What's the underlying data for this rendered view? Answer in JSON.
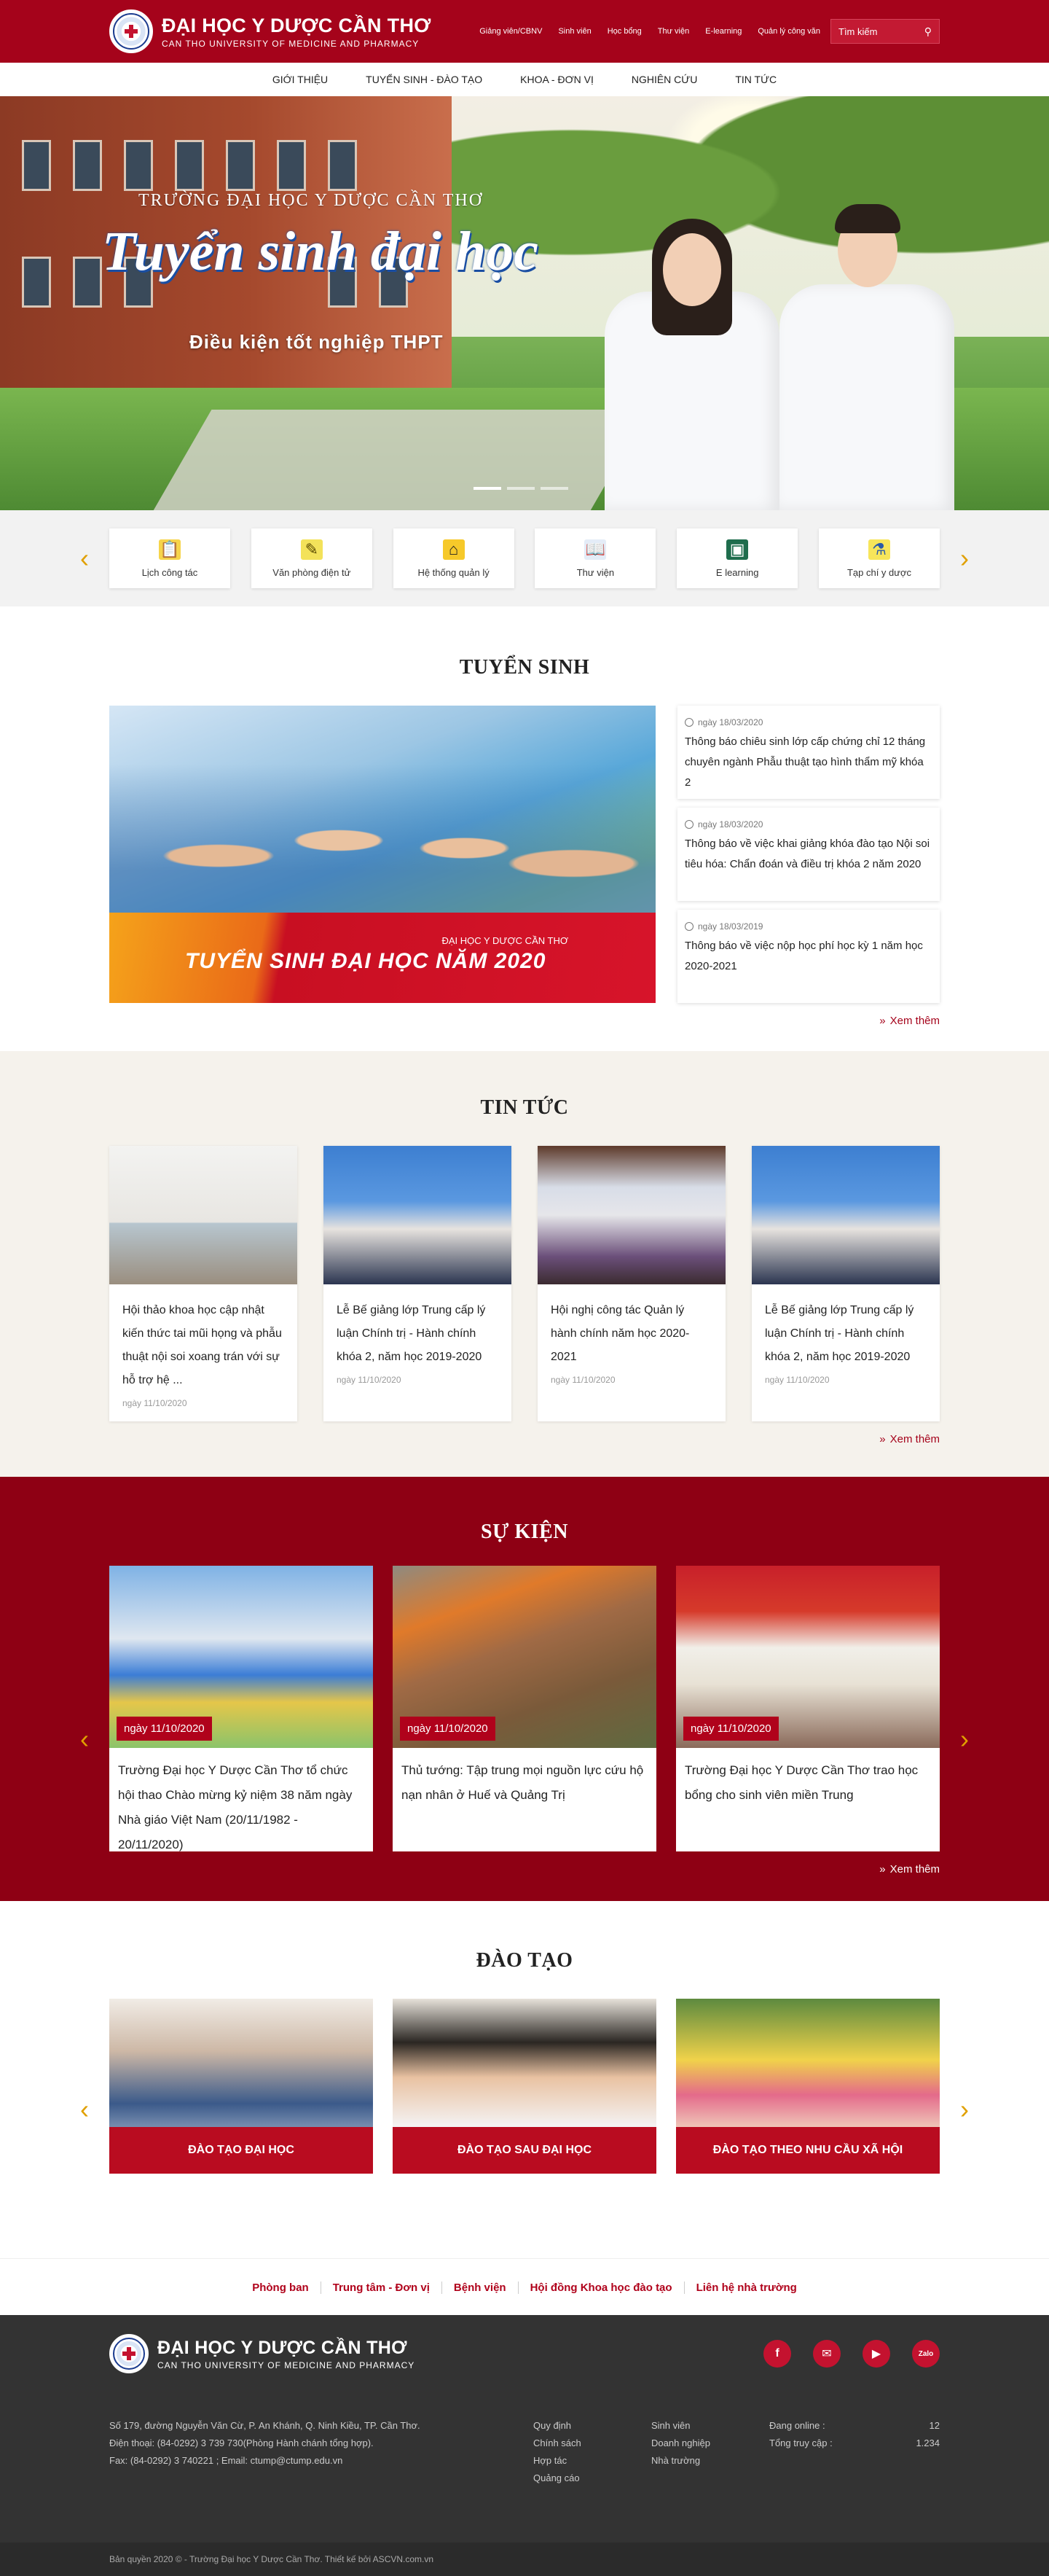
{
  "header": {
    "logo_title": "ĐẠI HỌC Y DƯỢC CẦN THƠ",
    "logo_subtitle": "CAN THO UNIVERSITY OF MEDICINE AND PHARMACY",
    "top_links": [
      "Giảng viên/CBNV",
      "Sinh viên",
      "Học bổng",
      "Thư viện",
      "E-learning",
      "Quản lý công văn"
    ],
    "search_placeholder": "Tìm kiếm"
  },
  "nav": [
    "GIỚI THIỆU",
    "TUYỂN SINH - ĐÀO TẠO",
    "KHOA - ĐƠN VỊ",
    "NGHIÊN CỨU",
    "TIN TỨC"
  ],
  "hero": {
    "subtitle": "TRƯỜNG ĐẠI HỌC Y DƯỢC CẦN THƠ",
    "title": "Tuyển sinh đại học",
    "condition": "Điều kiện tốt nghiệp THPT"
  },
  "quick_links": [
    {
      "label": "Lịch công tác",
      "icon": "clipboard-icon"
    },
    {
      "label": "Văn phòng điện tử",
      "icon": "pencil-icon"
    },
    {
      "label": "Hệ thống quản lý",
      "icon": "house-icon"
    },
    {
      "label": "Thư viện",
      "icon": "book-icon"
    },
    {
      "label": "E learning",
      "icon": "monitor-icon"
    },
    {
      "label": "Tạp chí y dược",
      "icon": "flask-icon"
    }
  ],
  "admission": {
    "title": "TUYỂN SINH",
    "banner_small": "ĐẠI HỌC Y DƯỢC CẦN THƠ",
    "banner_big": "TUYỂN SINH ĐẠI HỌC NĂM 2020",
    "items": [
      {
        "date": "ngày 18/03/2020",
        "title": "Thông báo chiêu sinh lớp cấp chứng chỉ 12 tháng chuyên ngành Phẫu thuật tạo hình thẩm mỹ khóa 2"
      },
      {
        "date": "ngày 18/03/2020",
        "title": "Thông báo về việc khai giảng khóa đào tạo Nội soi tiêu hóa: Chẩn đoán và điều trị khóa 2 năm 2020"
      },
      {
        "date": "ngày 18/03/2019",
        "title": "Thông báo về việc nộp học phí học kỳ 1 năm học 2020-2021"
      }
    ],
    "more": "Xem thêm"
  },
  "news": {
    "title": "TIN TỨC",
    "items": [
      {
        "title": "Hội thảo khoa học cập nhật kiến thức tai mũi họng và phẫu thuật nội soi xoang trán với sự hỗ trợ hệ ...",
        "date": "ngày 11/10/2020"
      },
      {
        "title": "Lễ Bế giảng lớp Trung cấp lý luận Chính trị - Hành chính khóa 2, năm học 2019-2020",
        "date": "ngày 11/10/2020"
      },
      {
        "title": "Hội nghị công tác Quản lý hành chính năm học 2020-2021",
        "date": "ngày 11/10/2020"
      },
      {
        "title": "Lễ Bế giảng lớp Trung cấp lý luận Chính trị - Hành chính khóa 2, năm học 2019-2020",
        "date": "ngày 11/10/2020"
      }
    ],
    "more": "Xem thêm"
  },
  "events": {
    "title": "SỰ KIỆN",
    "items": [
      {
        "date": "ngày 11/10/2020",
        "title": "Trường Đại học Y Dược Cần Thơ tổ chức hội thao Chào mừng kỷ niệm 38 năm ngày Nhà giáo Việt Nam (20/11/1982 - 20/11/2020)"
      },
      {
        "date": "ngày 11/10/2020",
        "title": "Thủ tướng: Tập trung mọi nguồn lực cứu hộ nạn nhân ở Huế và Quảng Trị"
      },
      {
        "date": "ngày 11/10/2020",
        "title": "Trường Đại học Y Dược Cần Thơ trao học bổng cho sinh viên miền Trung"
      }
    ],
    "more": "Xem thêm"
  },
  "training": {
    "title": "ĐÀO TẠO",
    "items": [
      "ĐÀO TẠO ĐẠI HỌC",
      "ĐÀO TẠO SAU ĐẠI HỌC",
      "ĐÀO TẠO  THEO NHU CẦU XÃ HỘI"
    ]
  },
  "bottom_links": [
    "Phòng ban",
    "Trung tâm - Đơn vị",
    "Bệnh viện",
    "Hội đồng Khoa học đào tạo",
    "Liên hệ nhà trường"
  ],
  "footer": {
    "address": "Số 179, đường Nguyễn Văn Cừ, P. An Khánh, Q. Ninh Kiều, TP. Cần Thơ.",
    "phone": "Điện thoại: (84-0292) 3 739 730(Phòng Hành chánh tổng hợp).",
    "fax": "Fax: (84-0292) 3 740221 ; Email: ctump@ctump.edu.vn",
    "col1": [
      "Quy định",
      "Chính sách",
      "Hợp tác",
      "Quảng cáo"
    ],
    "col2": [
      "Sinh viên",
      "Doanh nghiệp",
      "Nhà trường"
    ],
    "online_label": "Đang online :",
    "online_value": "12",
    "visits_label": "Tổng truy cập :",
    "visits_value": "1.234",
    "social": [
      "facebook-icon",
      "email-icon",
      "youtube-icon",
      "zalo-icon"
    ],
    "copyright": "Bản quyền 2020 © - Trường Đại học Y Dược Cần Thơ. Thiết kế bởi ASCVN.com.vn"
  },
  "colors": {
    "brand": "#a5031b",
    "event_bg": "#8e0014",
    "arrow": "#e0a000"
  }
}
